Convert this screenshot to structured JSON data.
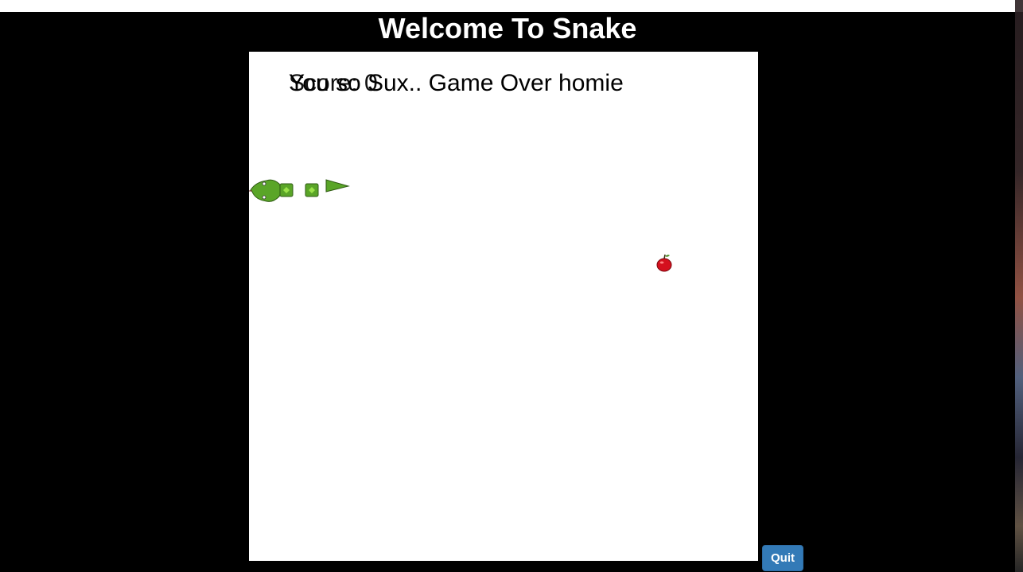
{
  "page": {
    "title": "Welcome To Snake"
  },
  "game": {
    "score_text": "Score: 0",
    "game_over_text": "You so Sux.. Game Over homie",
    "snake_color": "#5aa528",
    "apple_color": "#d4101e"
  },
  "controls": {
    "quit_label": "Quit"
  }
}
